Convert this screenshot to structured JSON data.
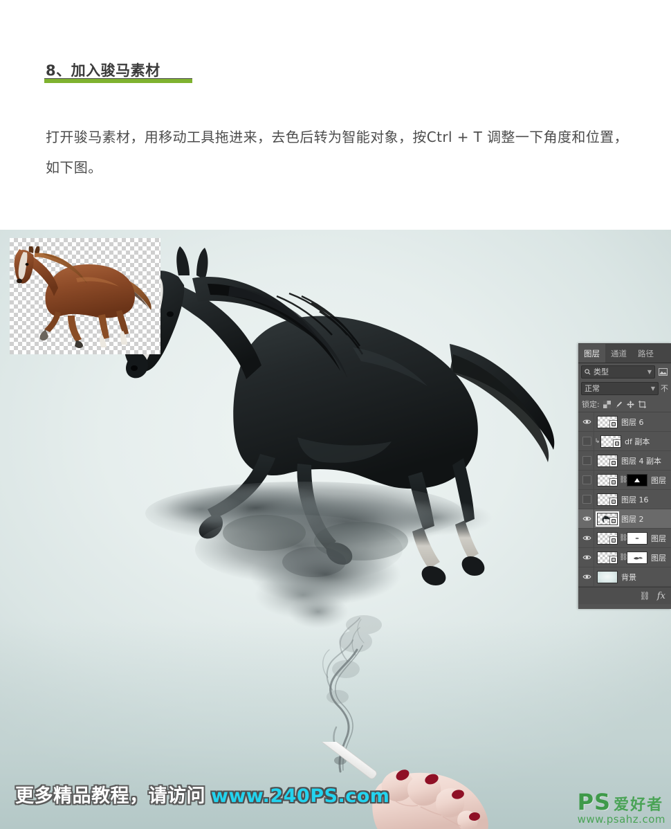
{
  "article": {
    "heading": "8、加入骏马素材",
    "body": "打开骏马素材，用移动工具拖进来，去色后转为智能对象，按Ctrl + T 调整一下角度和位置，如下图。",
    "accent_color": "#7fb22f"
  },
  "canvas": {
    "background_color": "#e3eceb",
    "inset_label": "reference-horse-cutout",
    "subject": "black-running-horse",
    "shadow": "smoke-shadow",
    "cigarette": "lit-cigarette-in-hand"
  },
  "ps_panel": {
    "tabs": [
      {
        "label": "图层",
        "active": true
      },
      {
        "label": "通道",
        "active": false
      },
      {
        "label": "路径",
        "active": false
      }
    ],
    "filter": {
      "kind_label": "类型",
      "search_icon": "search-icon"
    },
    "blend": {
      "mode": "正常",
      "opacity_label": "不"
    },
    "lock": {
      "label": "锁定:",
      "icons": [
        "transparency-lock-icon",
        "brush-lock-icon",
        "move-lock-icon",
        "artboard-lock-icon"
      ]
    },
    "layers": [
      {
        "name": "图层 6",
        "visible": true,
        "selected": false,
        "clipped": false,
        "linked": false,
        "mask": "none",
        "thumb": "transparent",
        "smart_object": true
      },
      {
        "name": "df 副本",
        "visible": false,
        "selected": false,
        "clipped": true,
        "linked": false,
        "mask": "none",
        "thumb": "transparent",
        "smart_object": true
      },
      {
        "name": "图层 4 副本",
        "visible": false,
        "selected": false,
        "clipped": false,
        "linked": false,
        "mask": "none",
        "thumb": "transparent",
        "smart_object": true
      },
      {
        "name": "图层",
        "visible": false,
        "selected": false,
        "clipped": false,
        "linked": true,
        "mask": "black",
        "thumb": "transparent",
        "smart_object": true
      },
      {
        "name": "图层 16",
        "visible": false,
        "selected": false,
        "clipped": false,
        "linked": false,
        "mask": "none",
        "thumb": "transparent",
        "smart_object": true
      },
      {
        "name": "图层 2",
        "visible": true,
        "selected": true,
        "clipped": false,
        "linked": false,
        "mask": "none",
        "thumb": "transparent",
        "smart_object": true
      },
      {
        "name": "图层",
        "visible": true,
        "selected": false,
        "clipped": false,
        "linked": true,
        "mask": "white",
        "thumb": "transparent",
        "smart_object": true
      },
      {
        "name": "图层",
        "visible": true,
        "selected": false,
        "clipped": false,
        "linked": true,
        "mask": "white-smoke",
        "thumb": "transparent",
        "smart_object": true
      },
      {
        "name": "背景",
        "visible": true,
        "selected": false,
        "clipped": false,
        "linked": false,
        "mask": "none",
        "thumb": "gradient",
        "smart_object": false
      }
    ],
    "footer": {
      "link_icon": "link-icon",
      "fx_label": "fx"
    }
  },
  "watermark": {
    "text_cn": "更多精品教程，请访问",
    "url": "www.240PS.com",
    "url_color": "#23d3ee"
  },
  "logo": {
    "mark": "PS",
    "name": "爱好者",
    "url": "www.psahz.com",
    "color": "#4aa356"
  }
}
